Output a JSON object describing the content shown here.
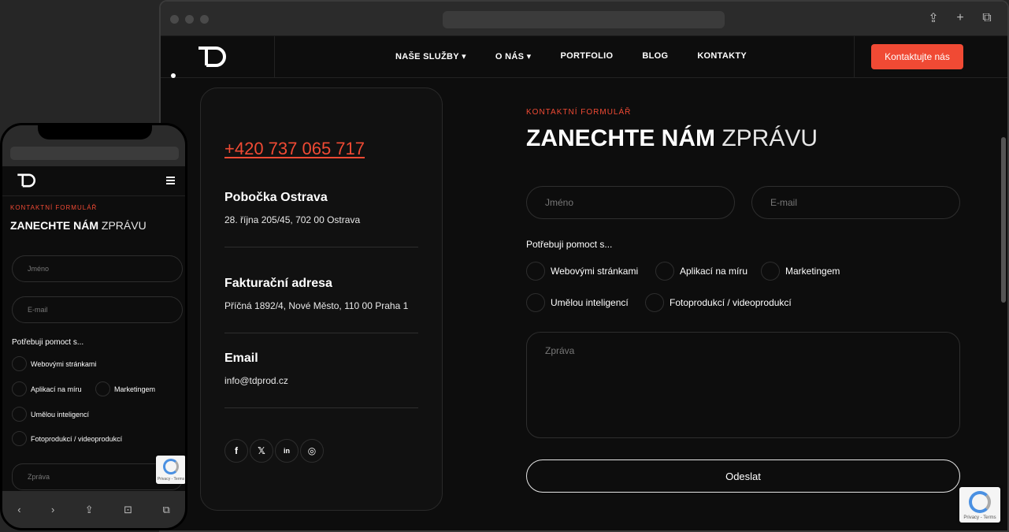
{
  "brand": {
    "logo_text": "TD",
    "accent": "#f04a34"
  },
  "desktop": {
    "nav": {
      "items": [
        {
          "label": "NAŠE SLUŽBY",
          "dropdown": true
        },
        {
          "label": "O NÁS",
          "dropdown": true
        },
        {
          "label": "PORTFOLIO",
          "dropdown": false
        },
        {
          "label": "BLOG",
          "dropdown": false
        },
        {
          "label": "KONTAKTY",
          "dropdown": false
        }
      ],
      "cta": "Kontaktujte nás"
    },
    "contact": {
      "phone": "+420 737 065 717",
      "blocks": [
        {
          "title": "Pobočka Ostrava",
          "text": "28. října 205/45, 702 00 Ostrava"
        },
        {
          "title": "Fakturační adresa",
          "text": "Příčná 1892/4, Nové Město, 110 00 Praha 1"
        },
        {
          "title": "Email",
          "text": "info@tdprod.cz"
        }
      ],
      "socials": [
        "facebook-icon",
        "x-icon",
        "linkedin-icon",
        "instagram-icon"
      ]
    },
    "form": {
      "eyebrow": "KONTAKTNÍ FORMULÁŘ",
      "heading_bold": "ZANECHTE NÁM",
      "heading_light": "ZPRÁVU",
      "name_placeholder": "Jméno",
      "email_placeholder": "E-mail",
      "help_label": "Potřebuji pomoct s...",
      "options": [
        "Webovými stránkami",
        "Aplikací na míru",
        "Marketingem",
        "Umělou inteligencí",
        "Fotoprodukcí / videoprodukcí"
      ],
      "message_placeholder": "Zpráva",
      "submit": "Odeslat"
    },
    "recaptcha": "Privacy - Terms"
  },
  "mobile": {
    "eyebrow": "KONTAKTNÍ FORMULÁŘ",
    "heading_bold": "ZANECHTE NÁM",
    "heading_light": "ZPRÁVU",
    "name_placeholder": "Jméno",
    "email_placeholder": "E-mail",
    "help_label": "Potřebuji pomoct s...",
    "options": [
      "Webovými stránkami",
      "Aplikací na míru",
      "Marketingem",
      "Umělou inteligencí",
      "Fotoprodukcí / videoprodukcí"
    ],
    "message_placeholder": "Zpráva",
    "recaptcha": "Privacy - Terms",
    "toolbar": [
      "‹",
      "›",
      "⇪",
      "⊡",
      "⧉"
    ]
  }
}
